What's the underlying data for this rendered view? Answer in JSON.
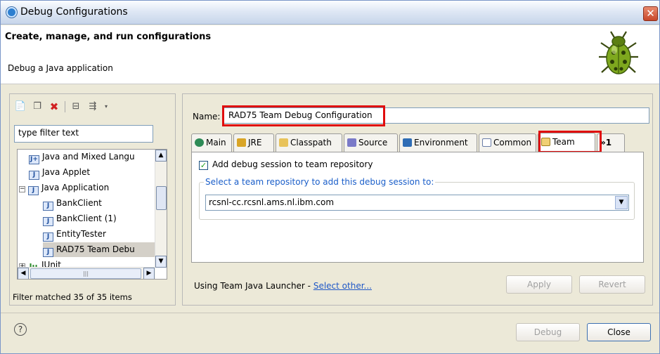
{
  "window": {
    "title": "Debug Configurations",
    "close_glyph": "✕"
  },
  "header": {
    "title": "Create, manage, and run configurations",
    "description": "Debug a Java application"
  },
  "left": {
    "filter_placeholder": "type filter text",
    "tree": [
      {
        "label": "Java and Mixed Langu",
        "icon": "J+"
      },
      {
        "label": "Java Applet",
        "icon": "J"
      },
      {
        "label": "Java Application",
        "icon": "J",
        "expander": "−"
      },
      {
        "label": "BankClient",
        "icon": "J"
      },
      {
        "label": "BankClient (1)",
        "icon": "J"
      },
      {
        "label": "EntityTester",
        "icon": "J"
      },
      {
        "label": "RAD75 Team Debu",
        "icon": "J"
      },
      {
        "label": "JUnit",
        "icon": "Ju",
        "expander": "+"
      }
    ],
    "status": "Filter matched 35 of 35 items"
  },
  "right": {
    "name_label": "Name:",
    "name_value": "RAD75 Team Debug Configuration",
    "tabs": [
      "Main",
      "JRE",
      "Classpath",
      "Source",
      "Environment",
      "Common",
      "Team",
      "»1"
    ],
    "checkbox_label": "Add debug session to team repository",
    "group_label": "Select a team repository to add this debug session to:",
    "repo_value": "rcsnl-cc.rcsnl.ams.nl.ibm.com",
    "launcher_text": "Using Team Java Launcher - ",
    "launcher_link": "Select other...",
    "apply": "Apply",
    "revert": "Revert"
  },
  "footer": {
    "help": "?",
    "debug": "Debug",
    "close": "Close"
  },
  "highlight_color": "#e00d0d"
}
